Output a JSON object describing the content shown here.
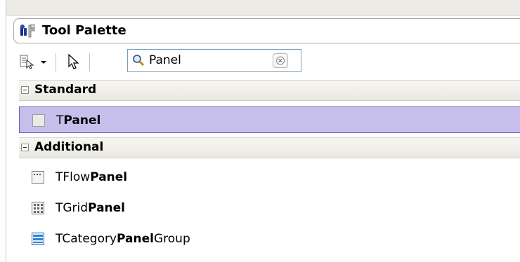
{
  "palette": {
    "title": "Tool Palette",
    "title_icon": "tool-palette-icon",
    "pin_icon": "pin-icon"
  },
  "toolbar": {
    "categories_icon": "categories-view-icon",
    "dropdown_icon": "chevron-down-icon",
    "pointer_icon": "pointer-arrow-icon",
    "search": {
      "value": "Panel",
      "search_icon": "magnifier-icon",
      "clear_icon": "clear-search-icon"
    }
  },
  "categories": [
    {
      "label": "Standard",
      "expanded": true,
      "items": [
        {
          "prefix": "T",
          "match": "Panel",
          "suffix": "",
          "icon": "tpanel-icon",
          "selected": true
        }
      ]
    },
    {
      "label": "Additional",
      "expanded": true,
      "items": [
        {
          "prefix": "TFlow",
          "match": "Panel",
          "suffix": "",
          "icon": "tflowpanel-icon",
          "selected": false
        },
        {
          "prefix": "TGrid",
          "match": "Panel",
          "suffix": "",
          "icon": "tgridpanel-icon",
          "selected": false
        },
        {
          "prefix": "TCategory",
          "match": "Panel",
          "suffix": "Group",
          "icon": "tcategorypanelgroup-icon",
          "selected": false
        }
      ]
    }
  ],
  "colors": {
    "selection_fill": "#c6bfec",
    "selection_border": "#6a5bbd",
    "category_header": "#e9e8e1"
  }
}
